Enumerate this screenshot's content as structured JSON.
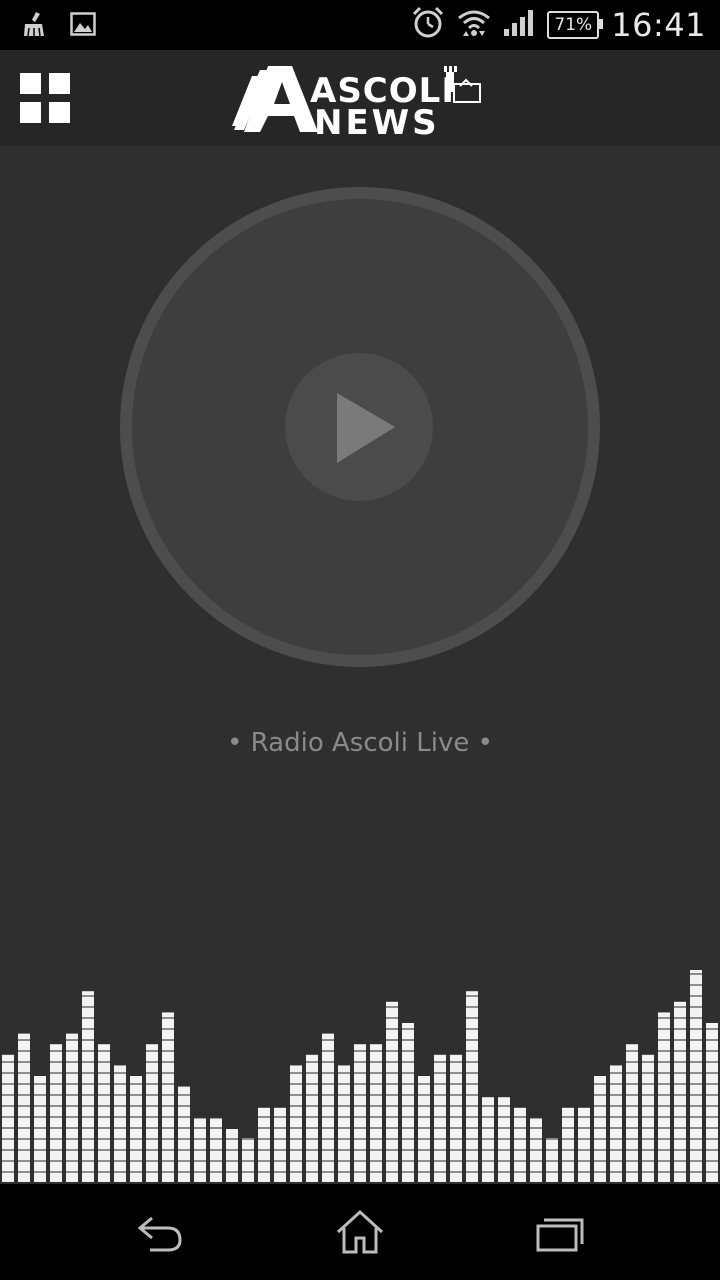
{
  "status_bar": {
    "time": "16:41",
    "battery_percent": "71%",
    "left_icons": [
      "cleaner-icon",
      "image-icon"
    ],
    "right_icons": [
      "alarm-icon",
      "wifi-icon",
      "signal-icon",
      "battery-icon"
    ]
  },
  "header": {
    "logo_line1": "ASCOLI",
    "logo_line2": "NEWS",
    "menu_icon": "grid-menu-icon"
  },
  "player": {
    "play_icon": "play-icon",
    "station_label": "• Radio Ascoli Live •"
  },
  "equalizer": {
    "max_level": 20,
    "levels": [
      12,
      14,
      10,
      13,
      14,
      18,
      13,
      11,
      10,
      13,
      16,
      9,
      6,
      6,
      5,
      4,
      7,
      7,
      11,
      12,
      14,
      11,
      13,
      13,
      17,
      15,
      10,
      12,
      12,
      18,
      8,
      8,
      7,
      6,
      4,
      7,
      7,
      10,
      11,
      13,
      12,
      16,
      17,
      20,
      15
    ]
  },
  "nav_bar": {
    "back_icon": "back-icon",
    "home_icon": "home-icon",
    "recents_icon": "recent-apps-icon"
  }
}
